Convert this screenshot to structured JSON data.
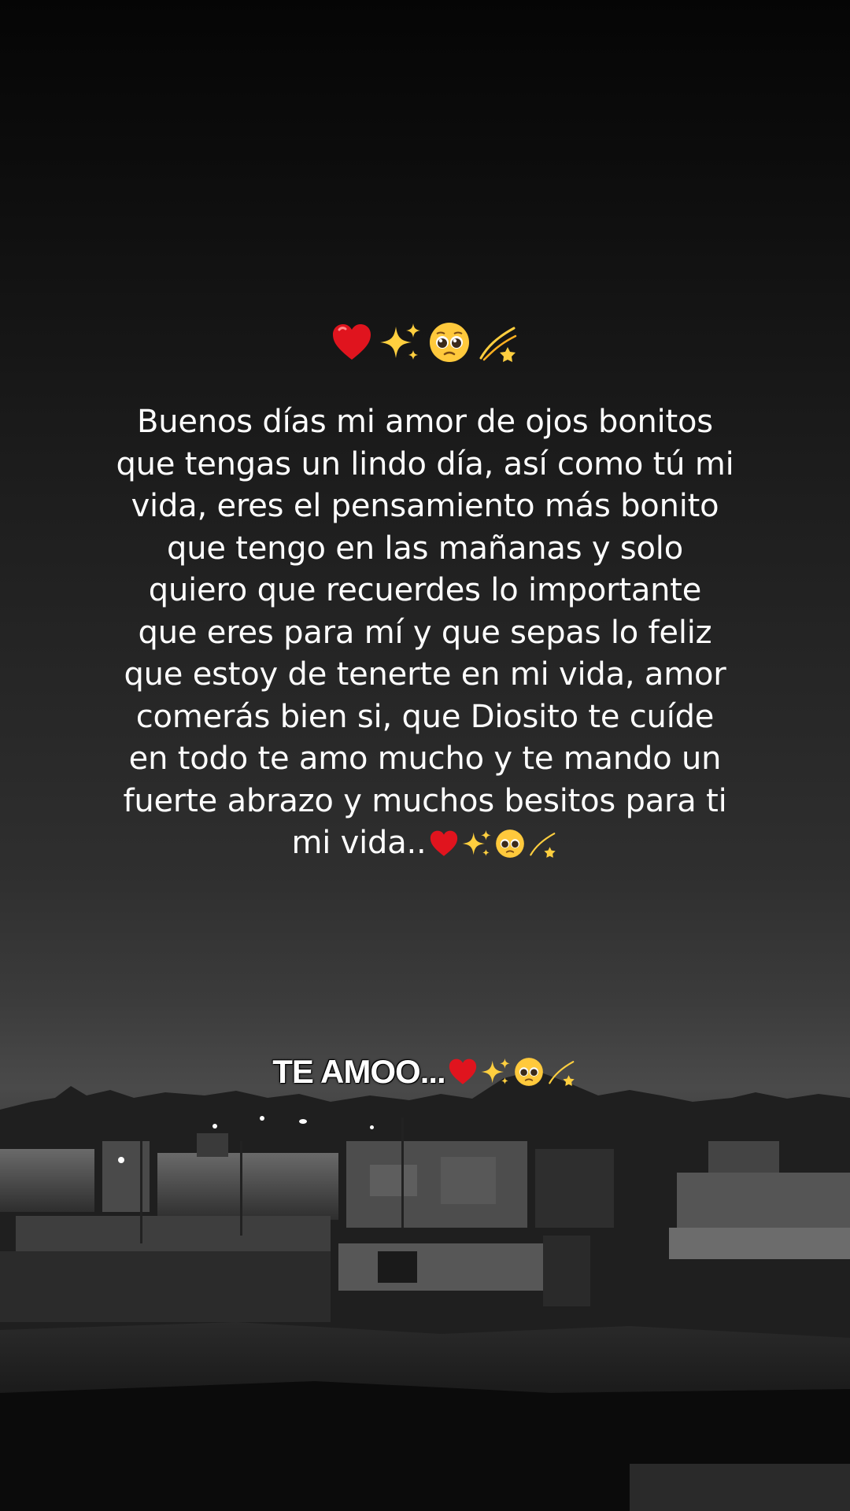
{
  "post": {
    "header_emojis": [
      "red-heart",
      "sparkles",
      "pleading-face",
      "dizzy"
    ],
    "message_lines": [
      "Buenos días mi amor de ojos bonitos",
      "que tengas un lindo día, así como tú mi",
      "vida, eres el pensamiento más bonito",
      "que tengo en las mañanas y solo",
      "quiero que recuerdes lo importante",
      "que eres para mí y que sepas lo feliz",
      "que estoy de tenerte en mi vida, amor",
      "comerás bien si, que Diosito te cuíde",
      "en todo te amo mucho y te mando un",
      "fuerte abrazo y muchos besitos para ti",
      "mi vida.."
    ],
    "closing_text": "TE AMOO...",
    "text_color": "#ffffff",
    "heart_color": "#e0141e",
    "sparkle_color": "#ffcf3f",
    "face_color": "#ffc93c"
  }
}
